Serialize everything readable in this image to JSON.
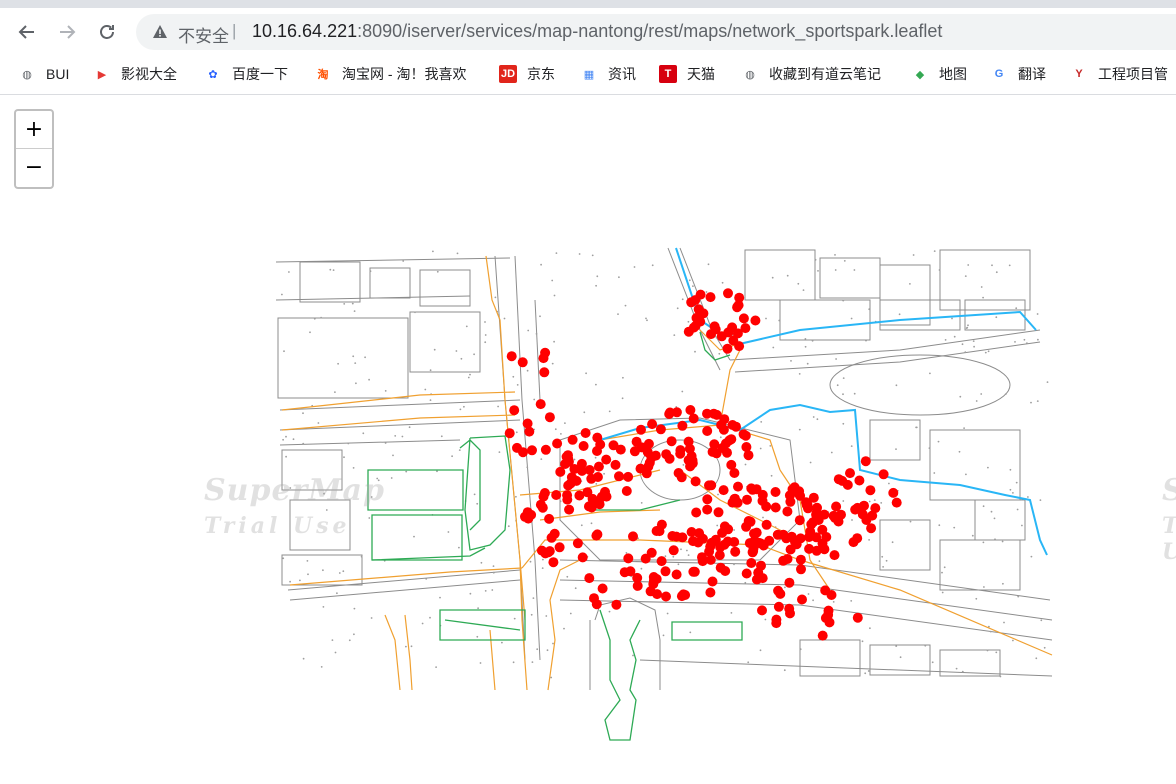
{
  "browser": {
    "back_icon": "arrow-left-icon",
    "forward_icon": "arrow-right-icon",
    "reload_icon": "reload-icon",
    "security_text": "不安全",
    "url_host": "10.16.64.221",
    "url_rest": ":8090/iserver/services/map-nantong/rest/maps/network_sportspark.leaflet"
  },
  "bookmarks": [
    {
      "label": "BUI",
      "icon": "globe-icon",
      "color": "#5f6368"
    },
    {
      "label": "影视大全",
      "icon": "play-icon",
      "color": "#e53935"
    },
    {
      "label": "百度一下",
      "icon": "baidu-paw-icon",
      "color": "#2962ff"
    },
    {
      "label": "淘宝网 - 淘！我喜欢",
      "icon": "taobao-icon",
      "color": "#ff5000"
    },
    {
      "label": "京东",
      "icon": "jd-icon",
      "color": "#e1251b"
    },
    {
      "label": "资讯",
      "icon": "news-icon",
      "color": "#4285f4"
    },
    {
      "label": "天猫",
      "icon": "tmall-icon",
      "color": "#d7000f"
    },
    {
      "label": "收藏到有道云笔记",
      "icon": "globe-icon",
      "color": "#5f6368"
    },
    {
      "label": "地图",
      "icon": "map-pin-icon",
      "color": "#34a853"
    },
    {
      "label": "翻译",
      "icon": "translate-icon",
      "color": "#4285f4"
    },
    {
      "label": "工程项目管",
      "icon": "logo-y-icon",
      "color": "#c62828"
    }
  ],
  "map": {
    "zoom_in_label": "+",
    "zoom_out_label": "−",
    "watermark_line1": "SuperMap",
    "watermark_line2": "Trial Use",
    "colors": {
      "road": "#8c8c8c",
      "pipe_orange": "#f0a030",
      "green_outline": "#2eaa55",
      "river": "#29b6f6",
      "point": "#ff0000"
    }
  }
}
